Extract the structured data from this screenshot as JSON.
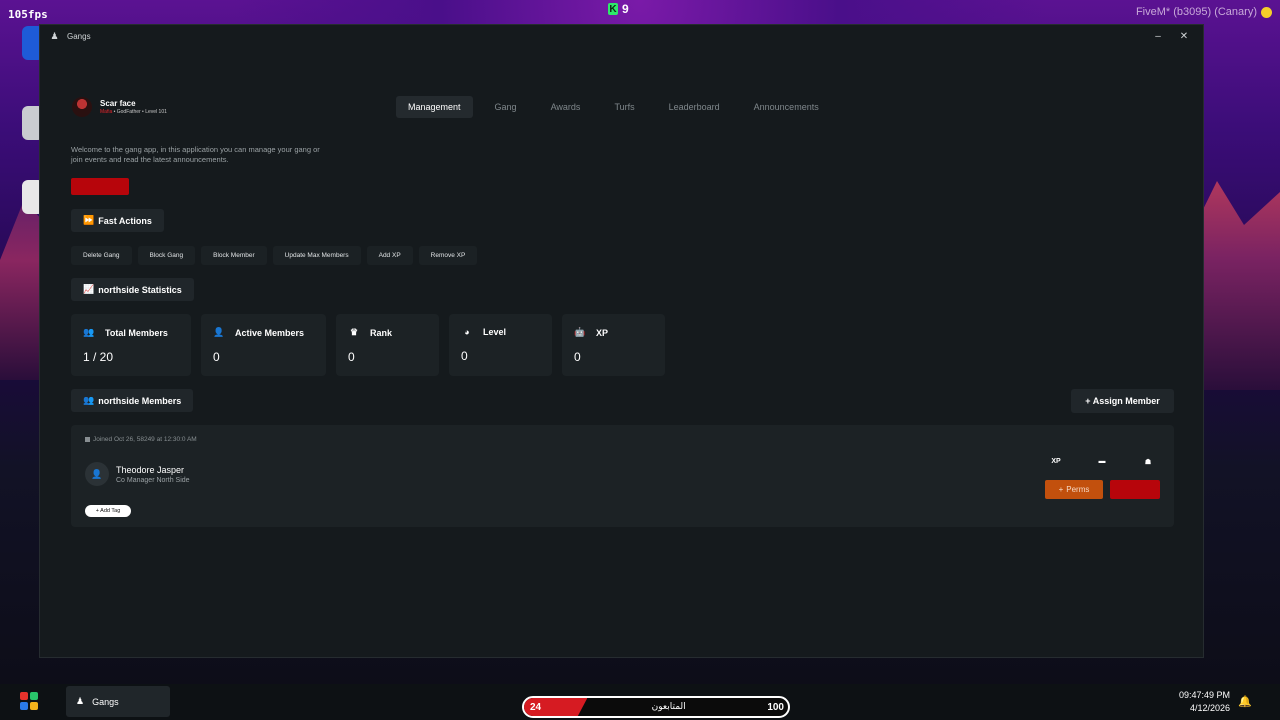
{
  "overlay": {
    "fps": "105fps",
    "counter": "9",
    "client": "FiveM* (b3095) (Canary)"
  },
  "window": {
    "title": "Gangs",
    "minimize": "–",
    "close": "✕"
  },
  "profile": {
    "name": "Scar face",
    "badge": "Mafia",
    "role": " • GodFather • Level 101"
  },
  "tabs": [
    {
      "label": "Management",
      "active": true
    },
    {
      "label": "Gang",
      "active": false
    },
    {
      "label": "Awards",
      "active": false
    },
    {
      "label": "Turfs",
      "active": false
    },
    {
      "label": "Leaderboard",
      "active": false
    },
    {
      "label": "Announcements",
      "active": false
    }
  ],
  "welcome": "Welcome to the gang app, in this application you can manage your gang or join events and read the latest announcements.",
  "fast_actions": {
    "title": "Fast Actions",
    "buttons": [
      "Delete Gang",
      "Block Gang",
      "Block Member",
      "Update Max Members",
      "Add XP",
      "Remove XP"
    ]
  },
  "statistics": {
    "title": "northside Statistics",
    "cards": [
      {
        "label": "Total Members",
        "value": "1 / 20",
        "icon": "users-icon"
      },
      {
        "label": "Active Members",
        "value": "0",
        "icon": "user-check-icon"
      },
      {
        "label": "Rank",
        "value": "0",
        "icon": "crown-icon"
      },
      {
        "label": "Level",
        "value": "0",
        "icon": "gauge-icon"
      },
      {
        "label": "XP",
        "value": "0",
        "icon": "robot-icon"
      }
    ]
  },
  "members": {
    "title": "northside Members",
    "assign_label": "+ Assign Member",
    "list": [
      {
        "joined": "Joined Oct 26, 58249 at 12:30:0 AM",
        "name": "Theodore Jasper",
        "role": "Co Manager North Side",
        "add_tag": "+ Add Tag",
        "xp_label": "XP",
        "perms_label": "Perms"
      }
    ]
  },
  "taskbar": {
    "app": "Gangs",
    "followers_label": "المتابعون",
    "followers_now": "24",
    "followers_max": "100",
    "followers_fill": 0.24,
    "time": "09:47:49 PM",
    "date": "4/12/2026"
  },
  "colors": {
    "window_bg": "#151a1d",
    "card_bg": "#1c2225",
    "danger": "#b7050b",
    "perms": "#c2500d"
  }
}
